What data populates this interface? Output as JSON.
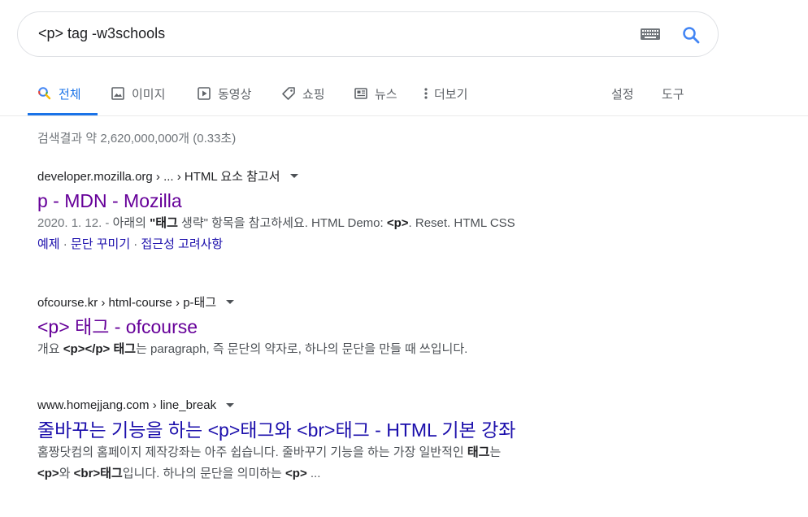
{
  "search": {
    "query": "<p> tag -w3schools",
    "keyboard_icon": "keyboard-icon",
    "search_icon": "search-icon"
  },
  "tabs": [
    {
      "label": "전체",
      "icon": "search-icon",
      "active": true
    },
    {
      "label": "이미지",
      "icon": "image-icon"
    },
    {
      "label": "동영상",
      "icon": "video-icon"
    },
    {
      "label": "쇼핑",
      "icon": "tag-icon"
    },
    {
      "label": "뉴스",
      "icon": "news-icon"
    },
    {
      "label": "더보기",
      "icon": "more-vert-icon"
    }
  ],
  "tools": {
    "settings": "설정",
    "tools": "도구"
  },
  "stats": "검색결과 약 2,620,000,000개 (0.33초)",
  "results": [
    {
      "cite": "developer.mozilla.org › ... › HTML 요소 참고서",
      "title": "p - MDN - Mozilla",
      "date": "2020. 1. 12. -",
      "snippet_parts": [
        " 아래의 ",
        "\"태그",
        " 생략\" 항목을 참고하세요. HTML Demo: ",
        "<p>",
        ". Reset. HTML CSS"
      ],
      "sitelinks": [
        "예제",
        "문단 꾸미기",
        "접근성 고려사항"
      ],
      "sep": " · "
    },
    {
      "cite": "ofcourse.kr › html-course › p-태그",
      "title": "<p> 태그 - ofcourse",
      "snippet_parts": [
        "개요 ",
        "<p></p> 태그",
        "는 paragraph, 즉 문단의 약자로, 하나의 문단을 만들 때 쓰입니다."
      ]
    },
    {
      "cite": "www.homejjang.com › line_break",
      "title": "줄바꾸는 기능을 하는 <p>태그와 <br>태그 - HTML 기본 강좌",
      "snippet_line1": [
        "홈짱닷컴의 홈페이지 제작강좌는 아주 쉽습니다. 줄바꾸기 기능을 하는 가장 일반적인 ",
        "태그",
        "는"
      ],
      "snippet_line2": [
        "<p>",
        "와 ",
        "<br>태그",
        "입니다. 하나의 문단을 의미하는 ",
        "<p>",
        " ..."
      ]
    }
  ],
  "colors": {
    "accent": "#1a73e8",
    "link_visited": "#660099",
    "link": "#1a0dab",
    "text": "#202124",
    "muted": "#70757a"
  }
}
